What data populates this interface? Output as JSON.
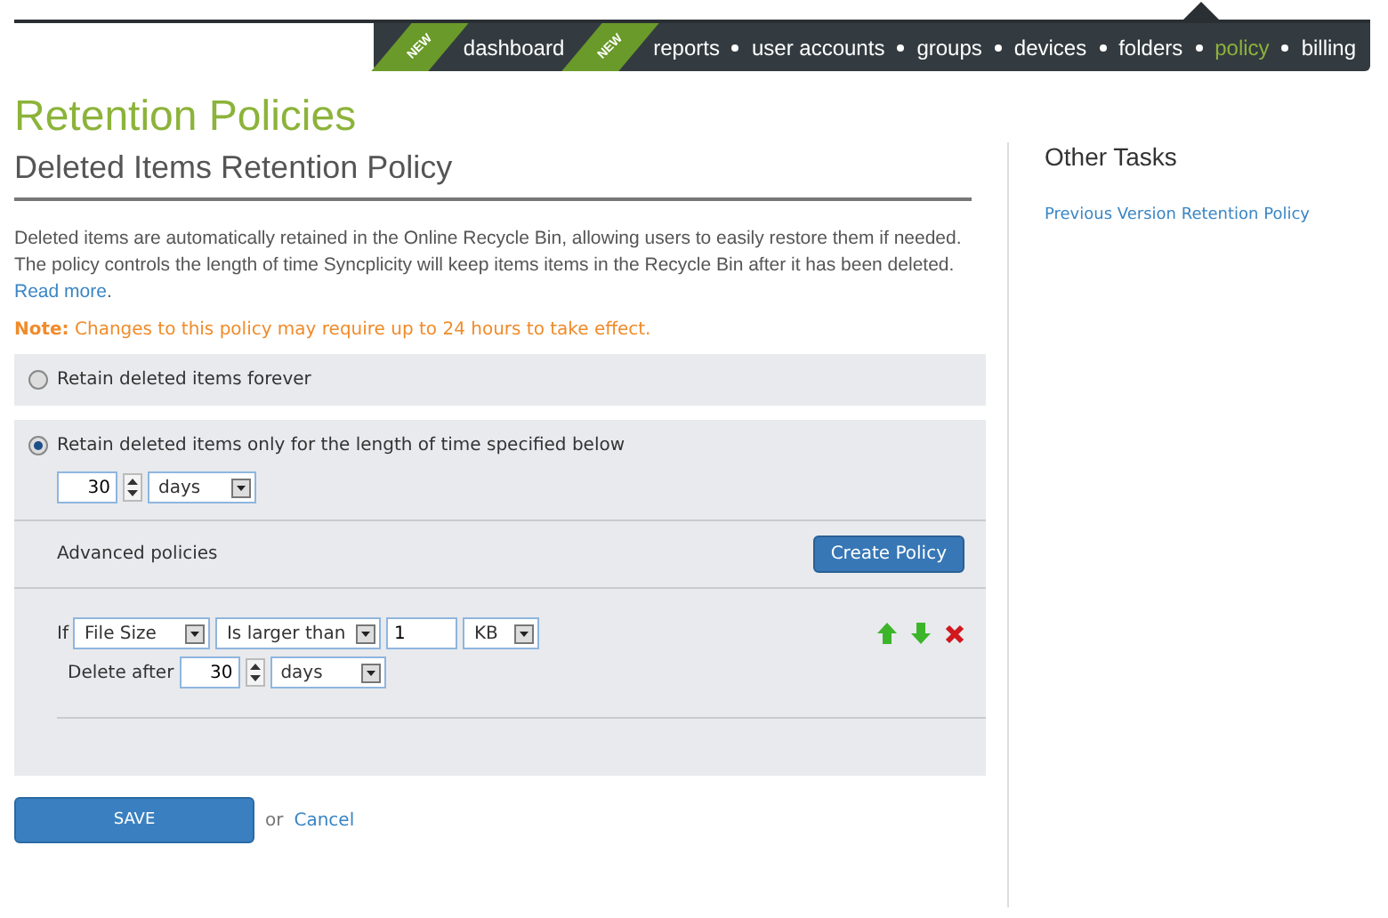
{
  "nav": {
    "items": [
      {
        "label": "dashboard",
        "badge": "NEW",
        "selected": false
      },
      {
        "label": "reports",
        "badge": "NEW",
        "selected": false
      },
      {
        "label": "user accounts",
        "selected": false
      },
      {
        "label": "groups",
        "selected": false
      },
      {
        "label": "devices",
        "selected": false
      },
      {
        "label": "folders",
        "selected": false
      },
      {
        "label": "policy",
        "selected": true
      },
      {
        "label": "billing",
        "selected": false
      }
    ]
  },
  "page": {
    "title": "Retention Policies",
    "subtitle": "Deleted Items Retention Policy",
    "description": {
      "text": "Deleted items are automatically retained in the Online Recycle Bin, allowing users to easily restore them if needed. The policy controls the length of time Syncplicity will keep items items in the Recycle Bin after it has been deleted.",
      "link": "Read more",
      "tail": "."
    },
    "note": {
      "label": "Note:",
      "text": "Changes to this policy may require up to 24 hours to take effect."
    },
    "options": [
      {
        "label": "Retain deleted items forever",
        "selected": false
      },
      {
        "label": "Retain deleted items only for the length of time specified below",
        "selected": true,
        "duration": {
          "value": "30",
          "unit": "days"
        },
        "advanced": {
          "label": "Advanced policies",
          "button": "Create Policy"
        },
        "rules": [
          {
            "if_label": "If",
            "field": "File Size",
            "operator": "Is larger than",
            "value": "1",
            "unit": "KB",
            "delete_label": "Delete after",
            "delete_value": "30",
            "delete_unit": "days"
          }
        ]
      }
    ],
    "actions": {
      "save": "SAVE",
      "or": "or",
      "cancel": "Cancel"
    }
  },
  "sidebar": {
    "title": "Other Tasks",
    "links": [
      "Previous Version Retention Policy"
    ]
  }
}
